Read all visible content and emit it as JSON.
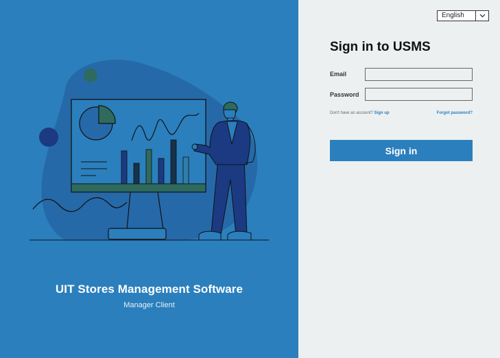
{
  "branding": {
    "app_title": "UIT Stores Management Software",
    "app_subtitle": "Manager Client"
  },
  "language": {
    "selected": "English"
  },
  "signin": {
    "title": "Sign in to USMS",
    "email_label": "Email",
    "email_value": "",
    "password_label": "Password",
    "password_value": "",
    "no_account_text": "Don't have an account?",
    "signup_link": "Sign up",
    "forgot_link": "Forgot password?",
    "submit_label": "Sign in"
  },
  "colors": {
    "accent": "#2b7fbd",
    "panel_bg": "#ecf0f1",
    "navy": "#1b3a82",
    "green": "#2e6b5e"
  },
  "icons": {
    "language_caret": "chevron-down-icon",
    "illustration": "presentation-illustration"
  }
}
